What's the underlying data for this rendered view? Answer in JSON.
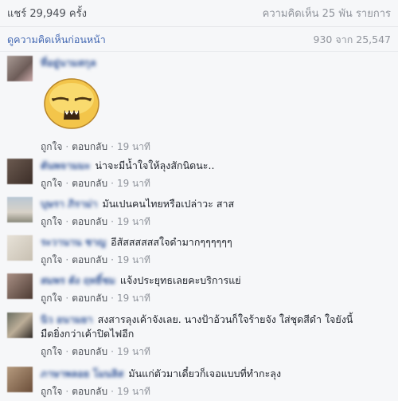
{
  "header": {
    "shares": "แชร์ 29,949 ครั้ง",
    "comments_total": "ความคิดเห็น 25 พัน รายการ"
  },
  "previous": {
    "label": "ดูความคิดเห็นก่อนหน้า",
    "paging": "930 จาก 25,547"
  },
  "actions": {
    "like": "ถูกใจ",
    "reply": "ตอบกลับ",
    "separator": "·"
  },
  "comments": [
    {
      "name": "ที่อยู่นามสกุล",
      "text": "",
      "sticker": "annoyed-face-sticker",
      "time": "19 นาที"
    },
    {
      "name": "ตันพจามมะ",
      "text": "น่าจะมีน้ำใจให้ลุงสักนิดนะ..",
      "time": "19 นาที"
    },
    {
      "name": "บุษรา ภิราม่า",
      "text": "มันเปนคนไทยหรือเปล่าวะ สาส",
      "time": "19 นาที"
    },
    {
      "name": "ระวานาน ชาญ",
      "text": "อีสัสสสสสสใจดำมากๆๆๆๆๆๆ",
      "time": "19 นาที"
    },
    {
      "name": "สมพร ตัง ฤทธิ์ชม",
      "text": "แจ้งประยุทธเลยคะบริการแย่",
      "time": "19 นาที"
    },
    {
      "name": "นิว อนามยา",
      "text": "สงสารลุงเค้าจังเลย. นางป้าอ้วนก็ใจร้ายจัง ใส่ชุดสีดำ ใจยังนี้มืดยิ่งกว่าเค้าปิดไฟอีก",
      "time": "19 นาที"
    },
    {
      "name": "ภาษาพลอย โมนลิส",
      "text": "มันแก่ตัวมาเดี๋ยวก็เจอแบบที่ทำกะลุง",
      "time": "19 นาที"
    }
  ],
  "colors": {
    "link": "#4267b2",
    "name": "#365899",
    "meta": "#90949c",
    "background": "#f6f7f9"
  }
}
